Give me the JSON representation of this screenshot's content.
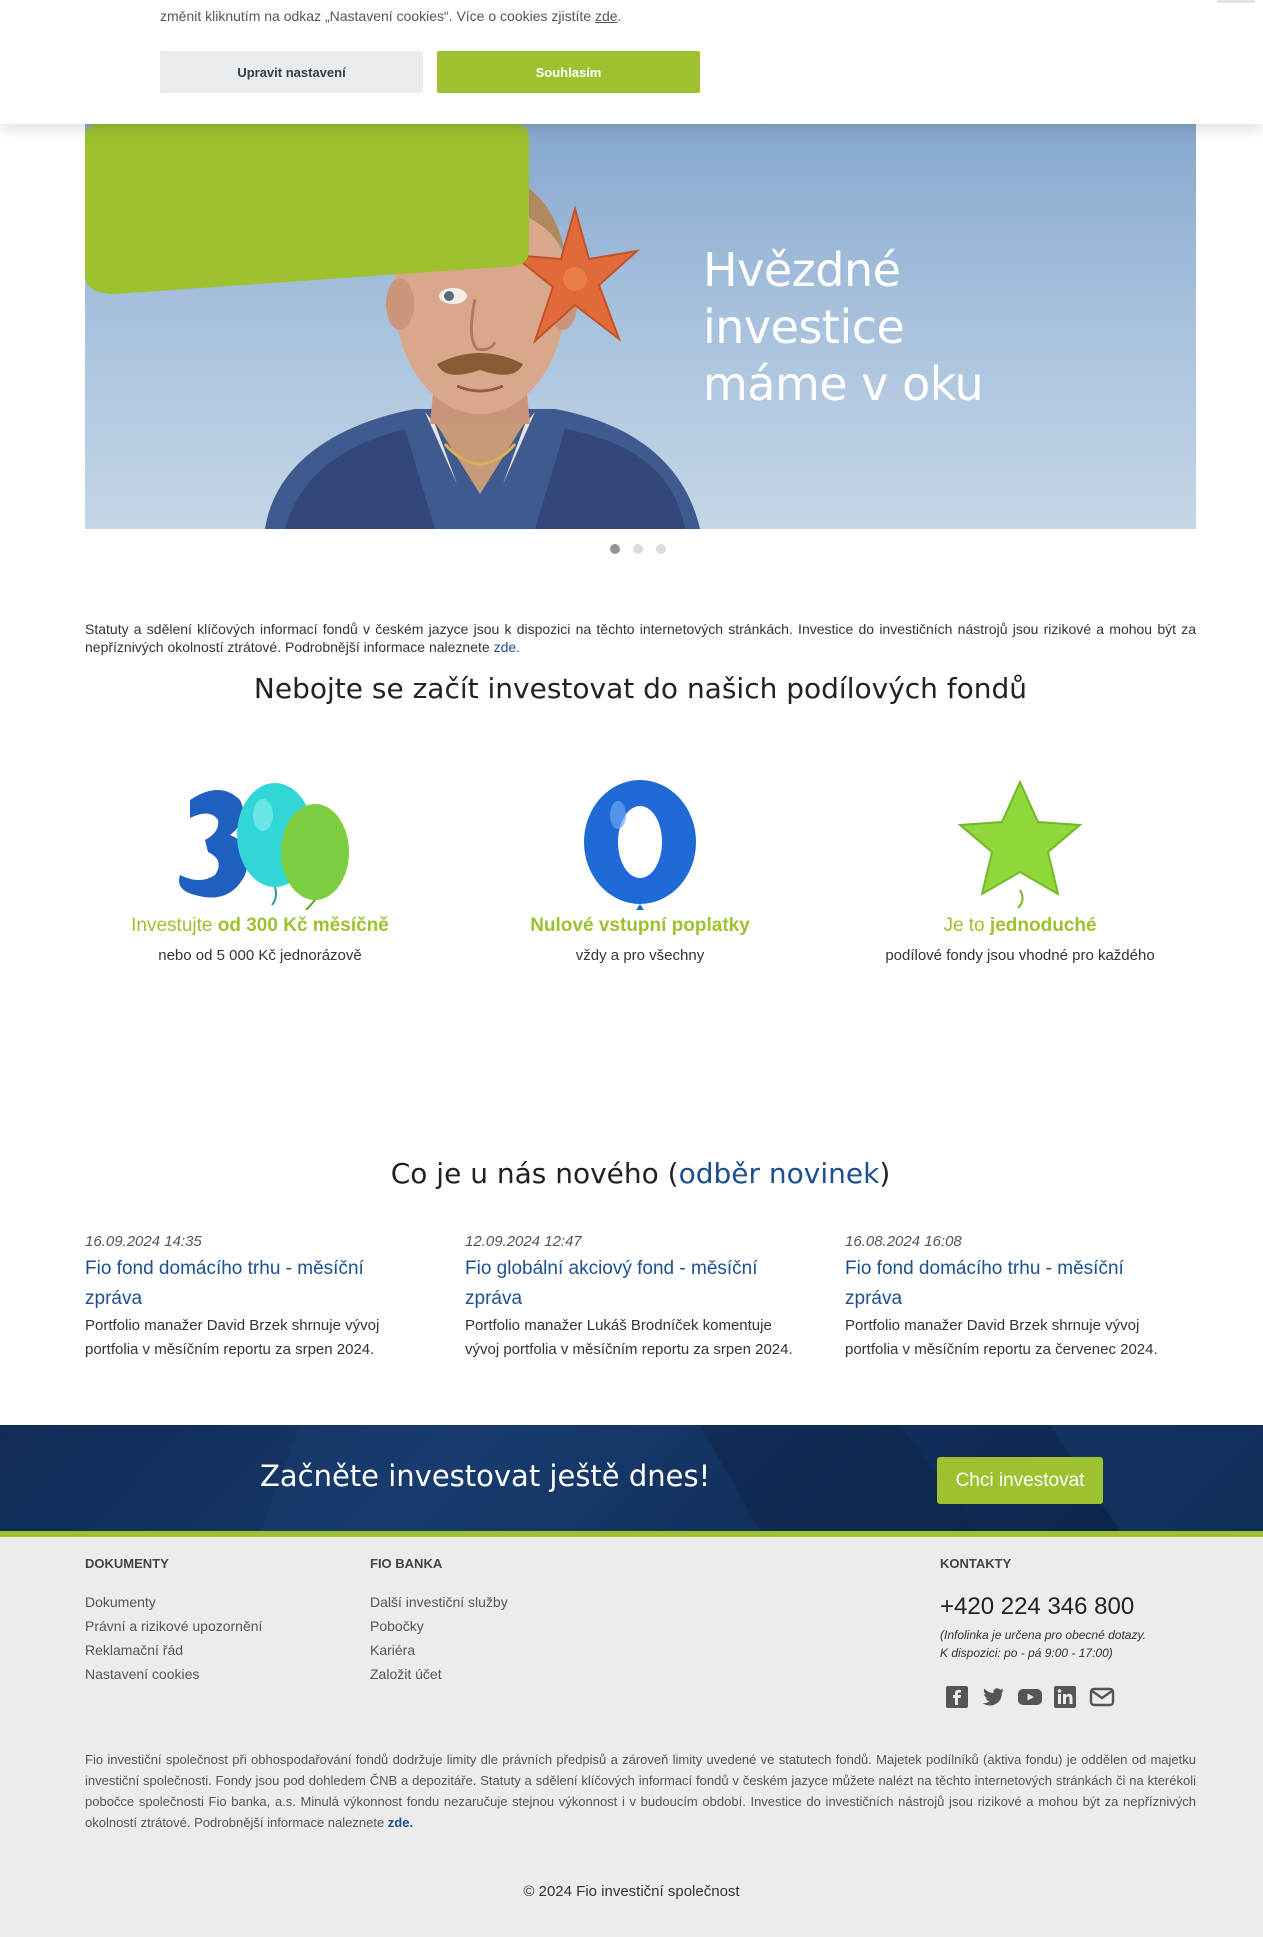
{
  "cookie": {
    "text_prefix": "změnit kliknutím na odkaz „Nastavení cookies“. Více o cookies zjistíte",
    "text_link": "zde",
    "settings_label": "Upravit nastavení",
    "agree_label": "Souhlasím"
  },
  "hero": {
    "title_line1": "Hvězdné investice",
    "title_line2": "máme v oku",
    "slides": 3,
    "active_slide": 1
  },
  "disclaimer": {
    "text": "Statuty a sdělení klíčových informací fondů v českém jazyce jsou k dispozici na těchto internetových stránkách. Investice do investičních nástrojů jsou rizikové a mohou být za nepříznivých okolností ztrátové. Podrobnější informace naleznete",
    "link": "zde."
  },
  "features": {
    "heading": "Nebojte se začít investovat do našich podílových fondů",
    "items": [
      {
        "title_a": "Investujte ",
        "title_b": "od 300 Kč měsíčně",
        "sub": "nebo od 5 000 Kč jednorázově"
      },
      {
        "title_a": "",
        "title_b": "Nulové vstupní poplatky",
        "sub": "vždy a pro všechny"
      },
      {
        "title_a": "Je to ",
        "title_b": "jednoduché",
        "sub": "podílové fondy jsou vhodné pro každého"
      }
    ]
  },
  "news": {
    "heading_a": "Co je u nás nového (",
    "heading_link": "odběr novinek",
    "heading_b": ")",
    "items": [
      {
        "date": "16.09.2024 14:35",
        "title_l1": "Fio fond domácího trhu - měsíční",
        "title_l2": "zpráva",
        "text_l1": "Portfolio manažer David Brzek shrnuje vývoj",
        "text_l2": "portfolia v měsíčním reportu za srpen 2024."
      },
      {
        "date": "12.09.2024 12:47",
        "title_l1": "Fio globální akciový fond - měsíční",
        "title_l2": "zpráva",
        "text_l1": "Portfolio manažer Lukáš Brodníček komentuje",
        "text_l2": "vývoj portfolia v měsíčním reportu za srpen 2024."
      },
      {
        "date": "16.08.2024 16:08",
        "title_l1": "Fio fond domácího trhu - měsíční",
        "title_l2": "zpráva",
        "text_l1": "Portfolio manažer David Brzek shrnuje vývoj",
        "text_l2": "portfolia v měsíčním reportu za červenec 2024."
      }
    ]
  },
  "banner": {
    "text": "Začněte investovat ještě dnes!",
    "button": "Chci investovat"
  },
  "footer": {
    "documents": {
      "title": "DOKUMENTY",
      "items": [
        "Dokumenty",
        "Právní a rizikové upozornění",
        "Reklamační řád",
        "Nastavení cookies"
      ]
    },
    "bank": {
      "title": "FIO BANKA",
      "items": [
        "Další investiční služby",
        "Pobočky",
        "Kariéra",
        "Založit účet"
      ]
    },
    "contacts": {
      "title": "KONTAKTY",
      "phone": "+420 224 346 800",
      "note_l1": "(Infolinka je určena pro obecné dotazy.",
      "note_l2": "K dispozici: po - pá 9:00 - 17:00)"
    },
    "socials": [
      "facebook-icon",
      "twitter-icon",
      "youtube-icon",
      "linkedin-icon",
      "mail-icon"
    ],
    "legal": "Fio investiční společnost při obhospodařování fondů dodržuje limity dle právních předpisů a zároveň limity uvedené ve statutech fondů. Majetek podílníků (aktiva fondu) je oddělen od majetku investiční společnosti. Fondy jsou pod dohledem ČNB a depozitáře. Statuty a sdělení klíčových informací fondů v českém jazyce můžete nalézt na těchto internetových stránkách či na kterékoli pobočce společnosti Fio banka, a.s. Minulá výkonnost fondu nezaručuje stejnou výkonnost i v budoucím období. Investice do investičních nástrojů jsou rizikové a mohou být za nepříznivých okolností ztrátové. Podrobnější informace naleznete",
    "legal_link": "zde.",
    "copyright": "© 2024 Fio investiční společnost"
  },
  "colors": {
    "brand_green": "#9dc12f",
    "brand_blue": "#1d4f91",
    "banner_navy": "#0f2a52"
  }
}
